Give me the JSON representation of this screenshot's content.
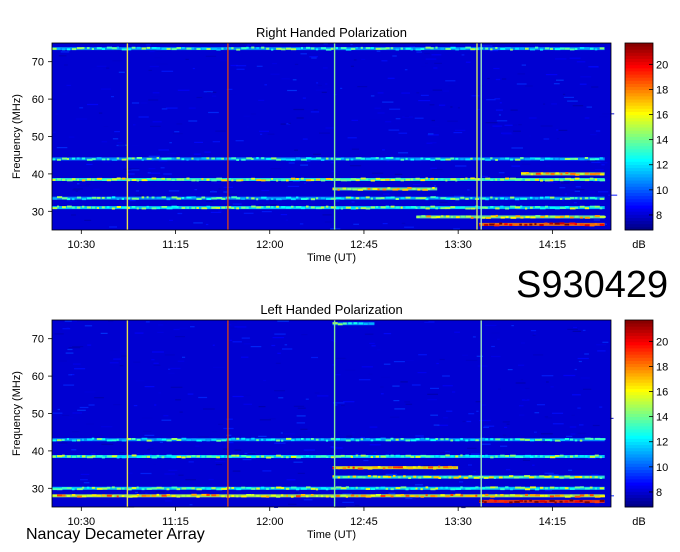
{
  "figure": {
    "observation_id": "S930429",
    "instrument": "Nancay Decameter Array"
  },
  "chart_data": [
    {
      "type": "heatmap",
      "title": "Right Handed Polarization",
      "xlabel": "Time (UT)",
      "ylabel": "Frequency (MHz)",
      "x_ticks": [
        "10:30",
        "11:15",
        "12:00",
        "12:45",
        "13:30",
        "14:15"
      ],
      "y_ticks": [
        30,
        40,
        50,
        60,
        70
      ],
      "ylim": [
        25,
        75
      ],
      "xlim": [
        "10:16",
        "14:43"
      ],
      "colorbar": {
        "label": "dB",
        "ticks": [
          8,
          10,
          12,
          14,
          16,
          18,
          20
        ],
        "range": [
          6.8,
          21.7
        ]
      },
      "background_level_db": 8,
      "vertical_lines": [
        {
          "time": "10:52",
          "color": "#e8e04a"
        },
        {
          "time": "11:40",
          "color": "#d04020"
        },
        {
          "time": "12:31",
          "color": "#7fe6a0"
        },
        {
          "time": "13:39",
          "color": "#d0e860"
        },
        {
          "time": "13:41",
          "color": "#9fe6c0"
        }
      ],
      "emission_bands": [
        {
          "freq_mhz": 26.5,
          "level_db": 20,
          "time_range": [
            "13:40",
            "14:40"
          ]
        },
        {
          "freq_mhz": 28.5,
          "level_db": 16,
          "time_range": [
            "13:10",
            "14:40"
          ]
        },
        {
          "freq_mhz": 31,
          "level_db": 14,
          "time_range": [
            "10:16",
            "14:40"
          ]
        },
        {
          "freq_mhz": 33.5,
          "level_db": 13,
          "time_range": [
            "10:16",
            "14:40"
          ]
        },
        {
          "freq_mhz": 36,
          "level_db": 16,
          "time_range": [
            "12:30",
            "13:20"
          ]
        },
        {
          "freq_mhz": 38.5,
          "level_db": 15,
          "time_range": [
            "10:16",
            "14:40"
          ]
        },
        {
          "freq_mhz": 40,
          "level_db": 17,
          "time_range": [
            "14:00",
            "14:40"
          ]
        },
        {
          "freq_mhz": 44,
          "level_db": 13,
          "time_range": [
            "10:16",
            "14:40"
          ]
        },
        {
          "freq_mhz": 73.5,
          "level_db": 13,
          "time_range": [
            "10:16",
            "14:40"
          ]
        }
      ]
    },
    {
      "type": "heatmap",
      "title": "Left Handed Polarization",
      "xlabel": "Time (UT)",
      "ylabel": "Frequency (MHz)",
      "x_ticks": [
        "10:30",
        "11:15",
        "12:00",
        "12:45",
        "13:30",
        "14:15"
      ],
      "y_ticks": [
        30,
        40,
        50,
        60,
        70
      ],
      "ylim": [
        25,
        75
      ],
      "xlim": [
        "10:16",
        "14:43"
      ],
      "colorbar": {
        "label": "dB",
        "ticks": [
          8,
          10,
          12,
          14,
          16,
          18,
          20
        ],
        "range": [
          6.8,
          21.7
        ]
      },
      "background_level_db": 8,
      "vertical_lines": [
        {
          "time": "10:52",
          "color": "#e8e04a"
        },
        {
          "time": "11:40",
          "color": "#d04020"
        },
        {
          "time": "12:31",
          "color": "#7fe6a0"
        },
        {
          "time": "13:41",
          "color": "#9fe6c0"
        }
      ],
      "emission_bands": [
        {
          "freq_mhz": 26.5,
          "level_db": 21,
          "time_range": [
            "13:40",
            "14:40"
          ]
        },
        {
          "freq_mhz": 28,
          "level_db": 17,
          "time_range": [
            "10:16",
            "14:40"
          ]
        },
        {
          "freq_mhz": 30,
          "level_db": 14,
          "time_range": [
            "10:16",
            "14:40"
          ]
        },
        {
          "freq_mhz": 33,
          "level_db": 15,
          "time_range": [
            "12:30",
            "14:40"
          ]
        },
        {
          "freq_mhz": 35.5,
          "level_db": 18,
          "time_range": [
            "12:30",
            "13:30"
          ]
        },
        {
          "freq_mhz": 38.5,
          "level_db": 14,
          "time_range": [
            "10:16",
            "14:40"
          ]
        },
        {
          "freq_mhz": 43,
          "level_db": 13,
          "time_range": [
            "10:16",
            "14:40"
          ]
        },
        {
          "freq_mhz": 74,
          "level_db": 13,
          "time_range": [
            "12:30",
            "12:50"
          ]
        }
      ]
    }
  ]
}
